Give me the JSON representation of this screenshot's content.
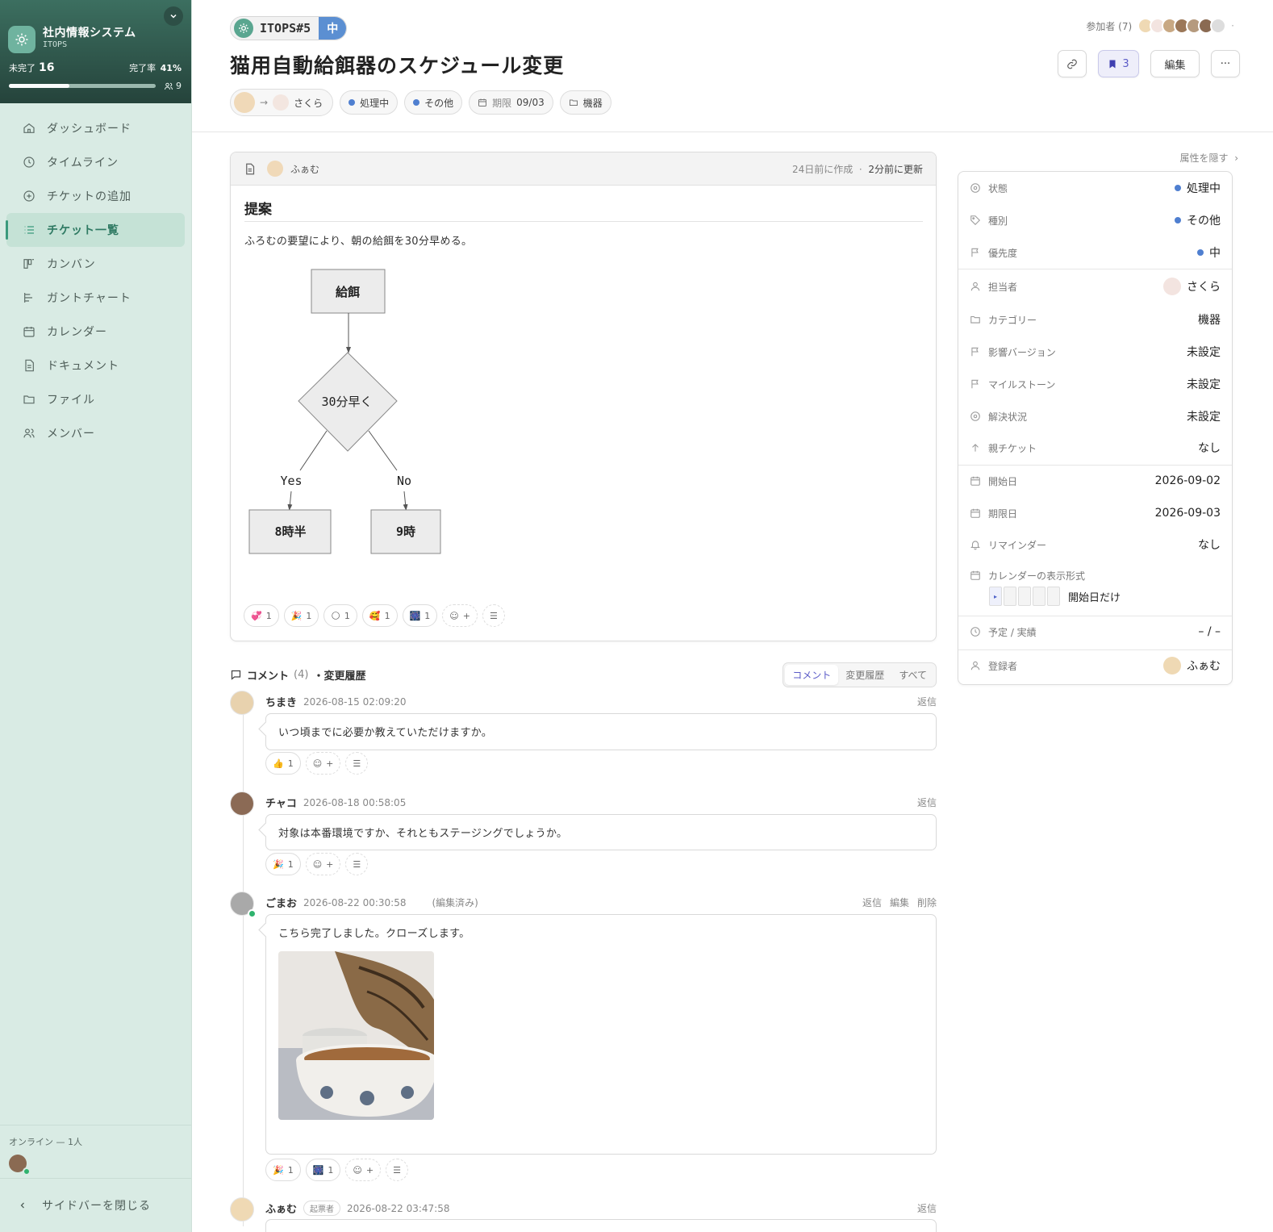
{
  "sidebar": {
    "title": "社内情報システム",
    "subtitle": "ITOPS",
    "incomplete_label": "未完了",
    "incomplete_count": "16",
    "completion_label": "完了率",
    "completion_rate": "41%",
    "completion_fraction": 0.41,
    "members_count": "9",
    "nav": [
      {
        "label": "ダッシュボード",
        "icon": "home-icon"
      },
      {
        "label": "タイムライン",
        "icon": "clock-icon"
      },
      {
        "label": "チケットの追加",
        "icon": "plus-circle-icon"
      },
      {
        "label": "チケット一覧",
        "icon": "list-icon",
        "active": true
      },
      {
        "label": "カンバン",
        "icon": "kanban-icon"
      },
      {
        "label": "ガントチャート",
        "icon": "gantt-icon"
      },
      {
        "label": "カレンダー",
        "icon": "calendar-icon"
      },
      {
        "label": "ドキュメント",
        "icon": "document-icon"
      },
      {
        "label": "ファイル",
        "icon": "folder-icon"
      },
      {
        "label": "メンバー",
        "icon": "users-icon"
      }
    ],
    "online_label": "オンライン — 1人",
    "close_label": "サイドバーを閉じる"
  },
  "header": {
    "ticket_id": "ITOPS#5",
    "priority": "中",
    "title": "猫用自動給餌器のスケジュール変更",
    "assignee": "さくら",
    "status": "処理中",
    "type": "その他",
    "due_label": "期限",
    "due": "09/03",
    "category": "機器",
    "participants_label": "参加者 (7)",
    "bookmark_count": "3",
    "edit_label": "編集",
    "more_label": "···"
  },
  "document": {
    "author": "ふぁむ",
    "created": "24日前に作成",
    "updated": "2分前に更新",
    "heading": "提案",
    "body": "ふろむの要望により、朝の給餌を30分早める。",
    "flow": {
      "start": "給餌",
      "decision": "30分早く",
      "yes": "Yes",
      "no": "No",
      "yes_result": "8時半",
      "no_result": "9時"
    },
    "reactions": [
      {
        "emoji": "💞",
        "count": "1"
      },
      {
        "emoji": "🎉",
        "count": "1"
      },
      {
        "emoji": "🌕",
        "count": "1"
      },
      {
        "emoji": "🥰",
        "count": "1"
      },
      {
        "emoji": "🎆",
        "count": "1"
      }
    ]
  },
  "comments_section": {
    "title": "コメント",
    "count": "(4)",
    "suffix": "・変更履歴",
    "tabs": [
      "コメント",
      "変更履歴",
      "すべて"
    ],
    "items": [
      {
        "name": "ちまき",
        "ts": "2026-08-15 02:09:20",
        "text": "いつ頃までに必要か教えていただけますか。",
        "reply": "返信",
        "reaction": "👍",
        "reaction_count": "1"
      },
      {
        "name": "チャコ",
        "ts": "2026-08-18 00:58:05",
        "text": "対象は本番環境ですか、それともステージングでしょうか。",
        "reply": "返信",
        "reaction": "🎉",
        "reaction_count": "1"
      },
      {
        "name": "ごまお",
        "ts": "2026-08-22 00:30:58",
        "edited": "(編集済み)",
        "text": "こちら完了しました。クローズします。",
        "reply": "返信",
        "edit": "編集",
        "delete": "削除",
        "reaction": "🎉",
        "reaction_count": "1",
        "reaction2": "🎆",
        "reaction2_count": "1"
      },
      {
        "name": "ふぁむ",
        "badge": "起票者",
        "ts": "2026-08-22 03:47:58",
        "reply": "返信"
      }
    ]
  },
  "properties": {
    "hide_label": "属性を隠す",
    "rows": [
      {
        "label": "状態",
        "value": "処理中"
      },
      {
        "label": "種別",
        "value": "その他"
      },
      {
        "label": "優先度",
        "value": "中"
      },
      {
        "label": "担当者",
        "value": "さくら"
      },
      {
        "label": "カテゴリー",
        "value": "機器"
      },
      {
        "label": "影響バージョン",
        "value": "未設定"
      },
      {
        "label": "マイルストーン",
        "value": "未設定"
      },
      {
        "label": "解決状況",
        "value": "未設定"
      },
      {
        "label": "親チケット",
        "value": "なし"
      },
      {
        "label": "開始日",
        "value": "2026-09-02"
      },
      {
        "label": "期限日",
        "value": "2026-09-03"
      },
      {
        "label": "リマインダー",
        "value": "なし"
      },
      {
        "label": "カレンダーの表示形式",
        "value": "開始日だけ"
      },
      {
        "label": "予定 / 実績",
        "value": "– / –"
      },
      {
        "label": "登録者",
        "value": "ふぁむ"
      }
    ]
  },
  "colors": {
    "accent": "#3b9a7d",
    "status_blue": "#4f7fd0",
    "priority_blue": "#5b8fd2"
  }
}
